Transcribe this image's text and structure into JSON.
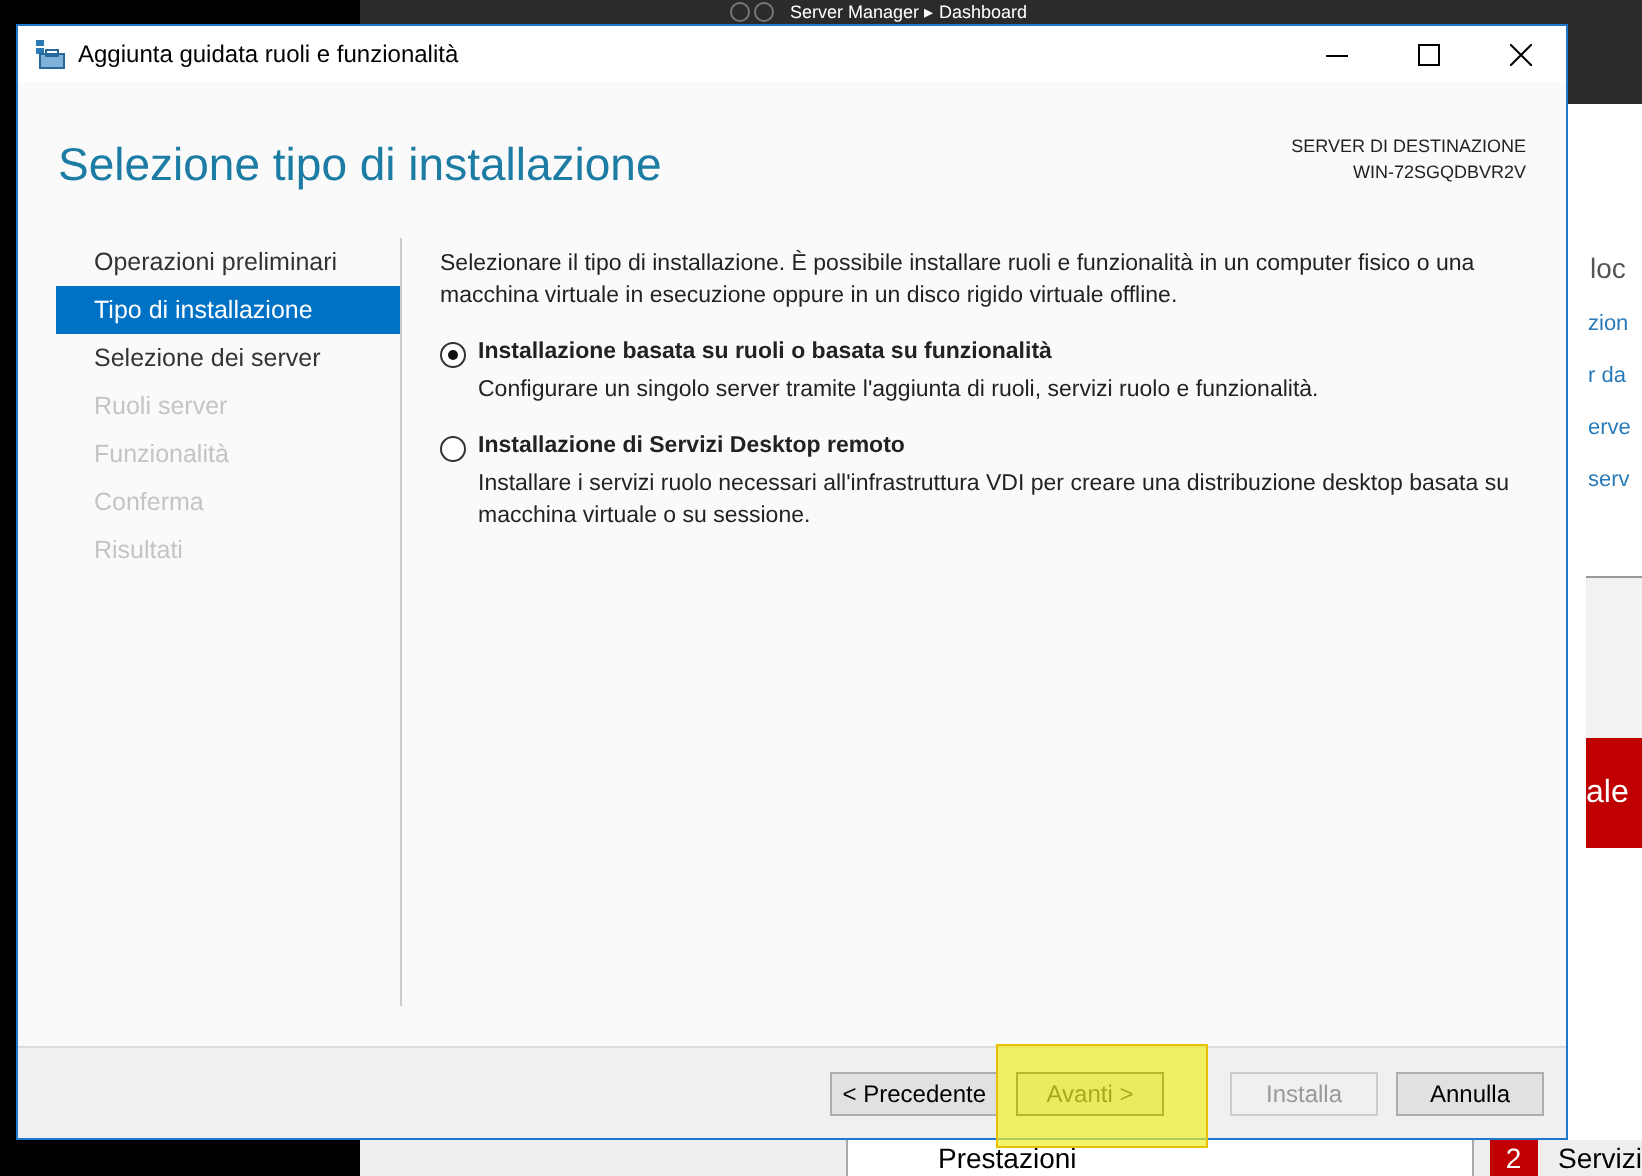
{
  "background_window": {
    "title": "Server Manager ▸ Dashboard",
    "side_texts": [
      "loc",
      "zion",
      "r da",
      "erve",
      "serv"
    ],
    "banner": "ale",
    "bottom_label": "Prestazioni",
    "badge": "2",
    "badge_label": "Servizi"
  },
  "window": {
    "title": "Aggiunta guidata ruoli e funzionalità"
  },
  "heading": "Selezione tipo di installazione",
  "destination": {
    "label": "SERVER DI DESTINAZIONE",
    "server": "WIN-72SGQDBVR2V"
  },
  "steps": [
    {
      "label": "Operazioni preliminari",
      "selected": false,
      "disabled": false
    },
    {
      "label": "Tipo di installazione",
      "selected": true,
      "disabled": false
    },
    {
      "label": "Selezione dei server",
      "selected": false,
      "disabled": false
    },
    {
      "label": "Ruoli server",
      "selected": false,
      "disabled": true
    },
    {
      "label": "Funzionalità",
      "selected": false,
      "disabled": true
    },
    {
      "label": "Conferma",
      "selected": false,
      "disabled": true
    },
    {
      "label": "Risultati",
      "selected": false,
      "disabled": true
    }
  ],
  "description": "Selezionare il tipo di installazione. È possibile installare ruoli e funzionalità in un computer fisico o una macchina virtuale in esecuzione oppure in un disco rigido virtuale offline.",
  "options": [
    {
      "label": "Installazione basata su ruoli o basata su funzionalità",
      "description": "Configurare un singolo server tramite l'aggiunta di ruoli, servizi ruolo e funzionalità.",
      "selected": true
    },
    {
      "label": "Installazione di Servizi Desktop remoto",
      "description": "Installare i servizi ruolo necessari all'infrastruttura VDI per creare una distribuzione desktop basata su macchina virtuale o su sessione.",
      "selected": false
    }
  ],
  "buttons": [
    {
      "label": "< Precedente",
      "disabled": false,
      "highlighted": false
    },
    {
      "label": "Avanti >",
      "disabled": false,
      "highlighted": true
    },
    {
      "label": "Installa",
      "disabled": true,
      "highlighted": false
    },
    {
      "label": "Annulla",
      "disabled": false,
      "highlighted": false
    }
  ]
}
